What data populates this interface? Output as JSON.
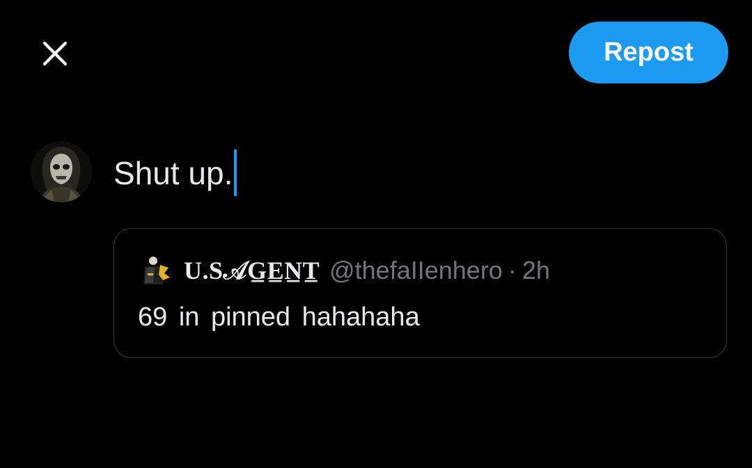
{
  "header": {
    "close_icon": "close-icon",
    "repost_label": "Repost",
    "accent_color": "#1d9bf0"
  },
  "compose": {
    "text": "Shut up.",
    "avatar_icon": "masked-figure-avatar"
  },
  "quoted_post": {
    "display_name": "U.S𝒜G̲E̲N̲T̲",
    "handle": "@thefaIIenhero",
    "separator": "·",
    "time": "2h",
    "text": "69 in pinned hahahaha",
    "avatar_icon": "soldier-avatar"
  }
}
